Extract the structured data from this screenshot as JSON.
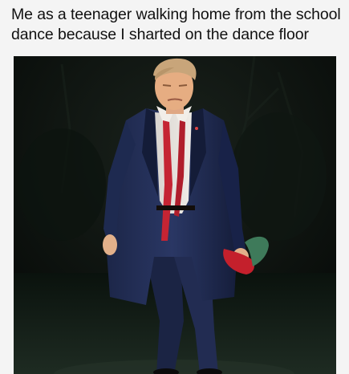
{
  "caption": {
    "lines": [
      "Me as a teenager walking home from the school",
      "dance because I sharted on the dance floor"
    ]
  }
}
